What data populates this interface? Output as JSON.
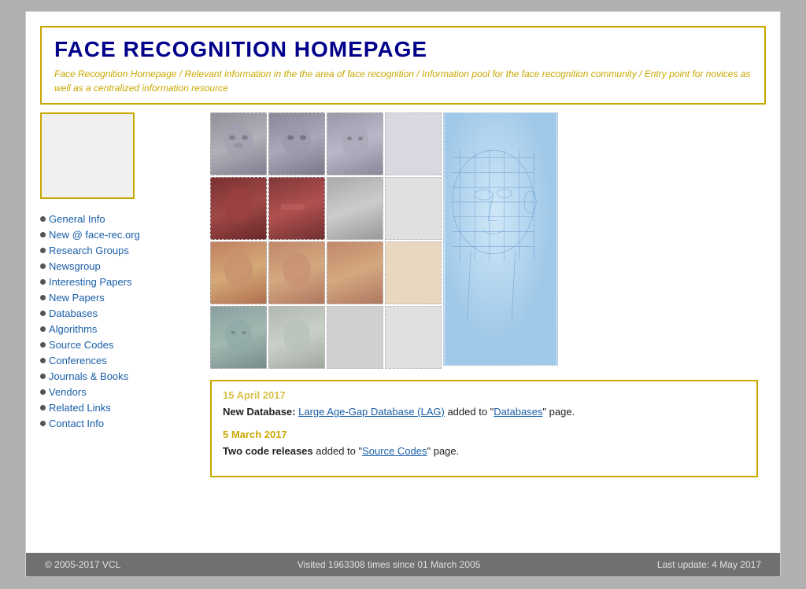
{
  "header": {
    "title": "FACE RECOGNITION HOMEPAGE",
    "subtitle": "Face Recognition Homepage / Relevant information in the the area of face recognition / Information pool for the face recognition community / Entry point for novices as well as a centralized information resource"
  },
  "sidebar": {
    "nav_items": [
      {
        "label": "General Info",
        "href": "#"
      },
      {
        "label": "New @ face-rec.org",
        "href": "#"
      },
      {
        "label": "Research Groups",
        "href": "#"
      },
      {
        "label": "Newsgroup",
        "href": "#"
      },
      {
        "label": "Interesting Papers",
        "href": "#"
      },
      {
        "label": "New Papers",
        "href": "#"
      },
      {
        "label": "Databases",
        "href": "#"
      },
      {
        "label": "Algorithms",
        "href": "#"
      },
      {
        "label": "Source Codes",
        "href": "#"
      },
      {
        "label": "Conferences",
        "href": "#"
      },
      {
        "label": "Journals & Books",
        "href": "#"
      },
      {
        "label": "Vendors",
        "href": "#"
      },
      {
        "label": "Related Links",
        "href": "#"
      },
      {
        "label": "Contact Info",
        "href": "#"
      }
    ]
  },
  "news": [
    {
      "date": "15 April 2017",
      "items": [
        {
          "prefix": "New Database:",
          "link_text": "Large Age-Gap Database (LAG)",
          "middle": " added to \"",
          "link2_text": "Databases",
          "suffix": "\" page."
        }
      ]
    },
    {
      "date": "5 March 2017",
      "items": [
        {
          "prefix": "Two code releases",
          "middle": " added to \"",
          "link2_text": "Source Codes",
          "suffix": "\" page."
        }
      ]
    }
  ],
  "footer": {
    "copyright": "© 2005-2017 VCL",
    "visits": "Visited 1963308 times since 01 March 2005",
    "last_update": "Last update: 4 May 2017"
  }
}
